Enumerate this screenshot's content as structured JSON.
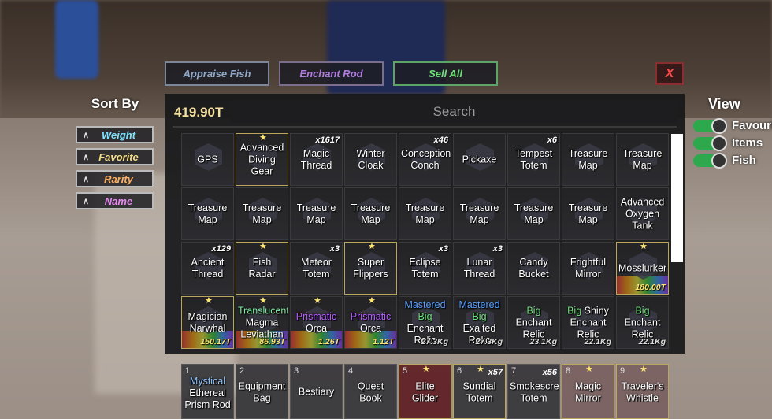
{
  "colors": {
    "balance": "#f4dfa0",
    "weight": "#7fe3ff",
    "favorite": "#f5e08a",
    "rarity": "#ffb061",
    "name": "#e58bf0",
    "toggle_on": "#2ea84d",
    "mastered": "#5aa0ff",
    "big": "#6ee07a",
    "prismatic": "#b65cff",
    "translucent": "#7cf0a0",
    "val_gold": "#ffe36e"
  },
  "top_buttons": {
    "appraise": "Appraise Fish",
    "enchant": "Enchant Rod",
    "sell": "Sell All",
    "close": "X"
  },
  "sort": {
    "title": "Sort By",
    "options": [
      "Weight",
      "Favorite",
      "Rarity",
      "Name"
    ]
  },
  "balance": "419.90T",
  "search_placeholder": "Search",
  "view": {
    "title": "View",
    "toggles": [
      "Favourites",
      "Items",
      "Fish"
    ]
  },
  "items": [
    {
      "name": "GPS",
      "icon": "gps-icon"
    },
    {
      "name": "Advanced Diving Gear",
      "star": true,
      "gold": true,
      "icon": "diving-gear-icon"
    },
    {
      "name": "Magic Thread",
      "qty": "x1617",
      "icon": "thread-icon"
    },
    {
      "name": "Winter Cloak",
      "icon": "cloak-icon"
    },
    {
      "name": "Conception Conch",
      "qty": "x46",
      "icon": "conch-icon"
    },
    {
      "name": "Pickaxe",
      "icon": "pickaxe-icon"
    },
    {
      "name": "Tempest Totem",
      "qty": "x6",
      "icon": "totem-icon"
    },
    {
      "name": "Treasure Map",
      "icon": "map-icon"
    },
    {
      "name": "Treasure Map",
      "icon": "map-icon"
    },
    {
      "name": "Treasure Map",
      "icon": "map-icon"
    },
    {
      "name": "Treasure Map",
      "icon": "map-icon"
    },
    {
      "name": "Treasure Map",
      "icon": "map-icon"
    },
    {
      "name": "Treasure Map",
      "icon": "map-icon"
    },
    {
      "name": "Treasure Map",
      "icon": "map-icon"
    },
    {
      "name": "Treasure Map",
      "icon": "map-icon"
    },
    {
      "name": "Treasure Map",
      "icon": "map-icon"
    },
    {
      "name": "Treasure Map",
      "icon": "map-icon"
    },
    {
      "name": "Advanced Oxygen Tank",
      "icon": "oxygen-tank-icon"
    },
    {
      "name": "Ancient Thread",
      "qty": "x129",
      "icon": "thread-icon"
    },
    {
      "name": "Fish Radar",
      "star": true,
      "gold": true,
      "icon": "radar-icon"
    },
    {
      "name": "Meteor Totem",
      "qty": "x3",
      "icon": "totem-icon"
    },
    {
      "name": "Super Flippers",
      "star": true,
      "gold": true,
      "icon": "flippers-icon"
    },
    {
      "name": "Eclipse Totem",
      "qty": "x3",
      "icon": "totem-icon"
    },
    {
      "name": "Lunar Thread",
      "qty": "x3",
      "icon": "thread-icon"
    },
    {
      "name": "Candy Bucket",
      "icon": "bucket-icon"
    },
    {
      "name": "Frightful Mirror",
      "icon": "mirror-icon"
    },
    {
      "name": "Mosslurker",
      "star": true,
      "gold": true,
      "value": "180.00T",
      "icon": "fish-icon"
    },
    {
      "name": "Magician Narwhal",
      "star": true,
      "gold": true,
      "value": "150.17T",
      "icon": "fish-icon"
    },
    {
      "name": "Translucent Magma Leviathan",
      "star": true,
      "value": "86.93T",
      "icon": "fish-icon"
    },
    {
      "name": "Prismatic Orca",
      "star": true,
      "value": "1.26T",
      "icon": "fish-icon"
    },
    {
      "name": "Prismatic Orca",
      "star": true,
      "value": "1.12T",
      "icon": "fish-icon"
    },
    {
      "name": "Mastered Big Enchant Relic",
      "weight": "27.3Kg",
      "icon": "relic-icon"
    },
    {
      "name": "Mastered Big Exalted Relic",
      "weight": "27.3Kg",
      "icon": "relic-icon"
    },
    {
      "name": "Big Enchant Relic",
      "weight": "23.1Kg",
      "icon": "relic-icon"
    },
    {
      "name": "Big Shiny Enchant Relic",
      "weight": "22.1Kg",
      "icon": "relic-icon"
    },
    {
      "name": "Big Enchant Relic",
      "weight": "22.1Kg",
      "icon": "relic-icon"
    }
  ],
  "hotbar": [
    {
      "num": "1",
      "name": "Mystical Ethereal Prism Rod",
      "icon": "rod-icon"
    },
    {
      "num": "2",
      "name": "Equipment Bag",
      "icon": "bag-icon"
    },
    {
      "num": "3",
      "name": "Bestiary",
      "icon": "book-icon"
    },
    {
      "num": "4",
      "name": "Quest Book",
      "icon": "book-icon"
    },
    {
      "num": "5",
      "name": "Elite Glider",
      "star": true,
      "icon": "glider-icon"
    },
    {
      "num": "6",
      "name": "Sundial Totem",
      "star": true,
      "qty": "x57",
      "icon": "totem-icon"
    },
    {
      "num": "7",
      "name": "Smokescreen Totem",
      "qty": "x56",
      "icon": "totem-icon"
    },
    {
      "num": "8",
      "name": "Magic Mirror",
      "star": true,
      "icon": "mirror-icon"
    },
    {
      "num": "9",
      "name": "Traveler's Whistle",
      "star": true,
      "icon": "whistle-icon"
    }
  ]
}
